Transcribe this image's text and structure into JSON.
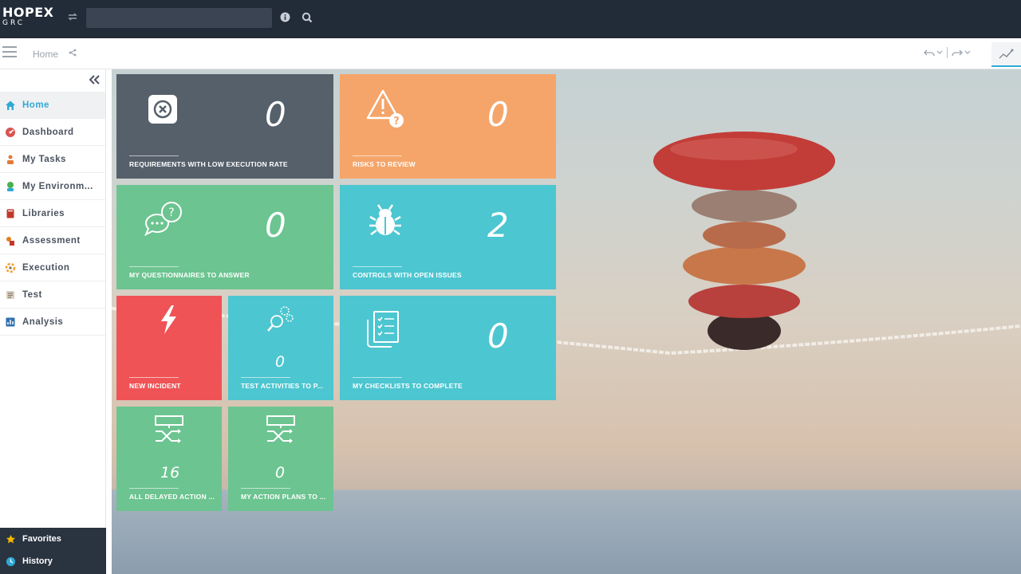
{
  "app": {
    "logo_line1": "HOPEX",
    "logo_line2": "GRC"
  },
  "search": {
    "placeholder": "",
    "value": ""
  },
  "breadcrumb": {
    "home": "Home"
  },
  "sidebar": {
    "items": [
      {
        "label": "Home",
        "icon": "house-icon",
        "color": "#2fa9d6",
        "active": true
      },
      {
        "label": "Dashboard",
        "icon": "dashboard-icon",
        "color": "#d9534f"
      },
      {
        "label": "My Tasks",
        "icon": "tasks-icon",
        "color": "#e07b39"
      },
      {
        "label": "My Environm...",
        "icon": "environment-icon",
        "color": "#4caf50"
      },
      {
        "label": "Libraries",
        "icon": "book-icon",
        "color": "#c0392b"
      },
      {
        "label": "Assessment",
        "icon": "assessment-icon",
        "color": "#e67e22"
      },
      {
        "label": "Execution",
        "icon": "execution-icon",
        "color": "#f0a030"
      },
      {
        "label": "Test",
        "icon": "test-icon",
        "color": "#8e7b6a"
      },
      {
        "label": "Analysis",
        "icon": "analysis-icon",
        "color": "#2f6fb0"
      }
    ],
    "bottom": [
      {
        "label": "Favorites",
        "icon": "star-icon",
        "color": "#f5b800"
      },
      {
        "label": "History",
        "icon": "history-icon",
        "color": "#2fa9d6"
      }
    ]
  },
  "tiles": [
    {
      "id": "requirements",
      "label": "REQUIREMENTS WITH LOW EXECUTION RATE",
      "value": "0",
      "color": "#55606b",
      "icon": "close-box-icon"
    },
    {
      "id": "risks",
      "label": "RISKS TO REVIEW",
      "value": "0",
      "color": "#f5a56a",
      "icon": "warning-question-icon"
    },
    {
      "id": "questionnaires",
      "label": "MY QUESTIONNAIRES TO ANSWER",
      "value": "0",
      "color": "#6cc490",
      "icon": "chat-question-icon"
    },
    {
      "id": "controls",
      "label": "CONTROLS WITH OPEN ISSUES",
      "value": "2",
      "color": "#4cc6d0",
      "icon": "bug-icon"
    },
    {
      "id": "incident",
      "label": "NEW INCIDENT",
      "value": "",
      "color": "#ef5356",
      "icon": "lightning-icon"
    },
    {
      "id": "test-activities",
      "label": "TEST ACTIVITIES TO P...",
      "value": "0",
      "color": "#4cc6d0",
      "icon": "gears-magnifier-icon"
    },
    {
      "id": "checklists",
      "label": "MY CHECKLISTS TO COMPLETE",
      "value": "0",
      "color": "#4cc6d0",
      "icon": "checklist-icon"
    },
    {
      "id": "delayed-actions",
      "label": "ALL DELAYED ACTION ...",
      "value": "16",
      "color": "#6cc490",
      "icon": "action-plan-icon"
    },
    {
      "id": "action-plans",
      "label": "MY ACTION PLANS TO ...",
      "value": "0",
      "color": "#6cc490",
      "icon": "action-plan-icon"
    }
  ]
}
